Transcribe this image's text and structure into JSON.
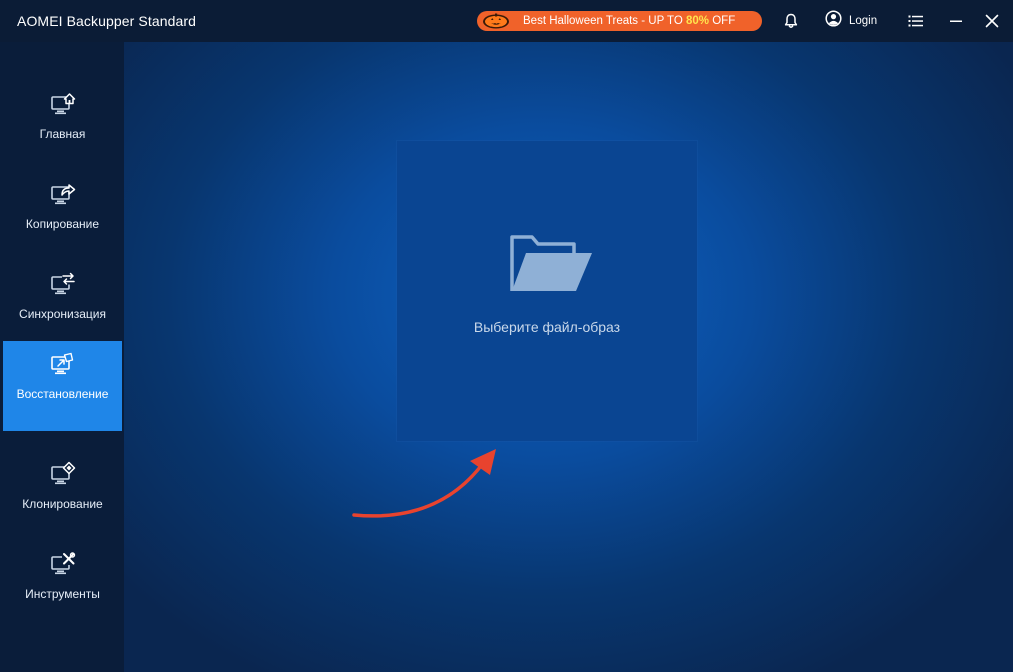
{
  "titlebar": {
    "app_title": "AOMEI Backupper Standard",
    "promo": {
      "text": "Best Halloween Treats - UP TO ",
      "highlight": "80%",
      "suffix": " OFF",
      "background": "#f0622a",
      "highlight_color": "#ffe44d"
    },
    "icons": {
      "notifications": "bell-icon",
      "login": "user-circle-icon",
      "menu": "list-menu-icon",
      "minimize": "minimize-icon",
      "close": "close-icon"
    },
    "login_label": "Login"
  },
  "sidebar": {
    "active_color": "#1f86e8",
    "items": [
      {
        "label": "Главная",
        "icon": "monitor-home-icon",
        "active": false
      },
      {
        "label": "Копирование",
        "icon": "monitor-share-icon",
        "active": false
      },
      {
        "label": "Синхронизация",
        "icon": "monitor-sync-icon",
        "active": false
      },
      {
        "label": "Восстановление",
        "icon": "monitor-restore-icon",
        "active": true
      },
      {
        "label": "Клонирование",
        "icon": "monitor-clone-icon",
        "active": false
      },
      {
        "label": "Инструменты",
        "icon": "monitor-tools-icon",
        "active": false
      }
    ]
  },
  "main": {
    "select_image": {
      "label": "Выберите файл-образ",
      "icon": "folder-open-icon"
    },
    "annotation": {
      "icon": "red-arrow-annotation",
      "color": "#e8432e"
    }
  }
}
